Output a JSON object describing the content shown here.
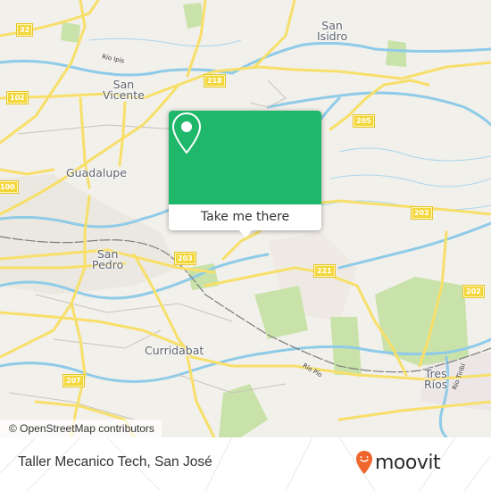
{
  "map": {
    "places": [
      {
        "id": "san-isidro",
        "lines": [
          "San",
          "Isidro"
        ]
      },
      {
        "id": "san-vicente",
        "lines": [
          "San",
          "Vicente"
        ]
      },
      {
        "id": "guadalupe",
        "lines": [
          "Guadalupe"
        ]
      },
      {
        "id": "san-pedro",
        "lines": [
          "San",
          "Pedro"
        ]
      },
      {
        "id": "curridabat",
        "lines": [
          "Curridabat"
        ]
      },
      {
        "id": "tres-rios",
        "lines": [
          "Tres",
          "Ríos"
        ]
      }
    ],
    "rivers": [
      {
        "id": "rio-ipis",
        "label": "Río Ipís"
      },
      {
        "id": "rio-pio",
        "label": "Río Pío"
      },
      {
        "id": "rio-tiribi",
        "label": "Río Tiribí"
      }
    ],
    "road_shields": [
      "32",
      "102",
      "218",
      "205",
      "100",
      "202",
      "203",
      "221",
      "202",
      "207"
    ],
    "attribution": "© OpenStreetMap contributors"
  },
  "popup": {
    "icon": "map-pin-icon",
    "cta_label": "Take me there",
    "accent_color": "#1fb76a"
  },
  "footer": {
    "place_name": "Taller Mecanico Tech, San José",
    "logo_text": "moovit",
    "logo_color": "#f0662c"
  }
}
